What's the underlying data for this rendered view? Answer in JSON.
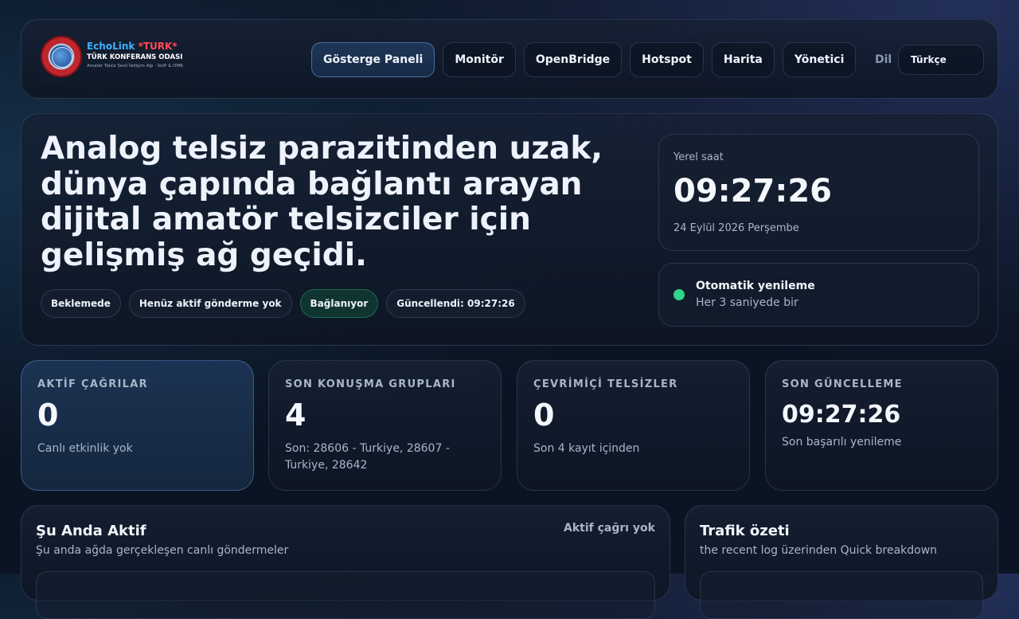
{
  "brand": {
    "title_part1": "EchoLink",
    "title_part2": "*TURK*",
    "subtitle": "TÜRK KONFERANS ODASI",
    "tagline": "Amatör Telsiz Sesli İletişim Ağı · VoIP & DMR"
  },
  "nav": {
    "items": [
      "Gösterge Paneli",
      "Monitör",
      "OpenBridge",
      "Hotspot",
      "Harita",
      "Yönetici"
    ],
    "active": "Gösterge Paneli",
    "lang_label": "Dil",
    "lang_value": "Türkçe"
  },
  "hero": {
    "title": "Analog telsiz parazitinden uzak, dünya çapında bağlantı arayan dijital amatör telsizciler için gelişmiş ağ geçidi.",
    "chips": [
      "Beklemede",
      "Henüz aktif gönderme yok",
      "Bağlanıyor",
      "Güncellendi: 09:27:26"
    ]
  },
  "clock": {
    "label": "Yerel saat",
    "time": "09:27:26",
    "date": "24 Eylül 2026 Perşembe"
  },
  "refresh": {
    "title": "Otomatik yenileme",
    "subtitle": "Her 3 saniyede bir",
    "status_color": "#2fd38a"
  },
  "stats": [
    {
      "label": "AKTİF ÇAĞRILAR",
      "value": "0",
      "desc": "Canlı etkinlik yok"
    },
    {
      "label": "SON KONUŞMA GRUPLARI",
      "value": "4",
      "desc": "Son: 28606 - Turkiye, 28607 - Turkiye, 28642"
    },
    {
      "label": "ÇEVRİMİÇİ TELSİZLER",
      "value": "0",
      "desc": "Son 4 kayıt içinden"
    },
    {
      "label": "SON GÜNCELLEME",
      "value": "09:27:26",
      "desc": "Son başarılı yenileme"
    }
  ],
  "active_now": {
    "title": "Şu Anda Aktif",
    "subtitle": "Şu anda ağda gerçekleşen canlı göndermeler",
    "badge": "Aktif çağrı yok"
  },
  "traffic": {
    "title": "Trafik özeti",
    "subtitle": "the recent log üzerinden Quick breakdown"
  },
  "colors": {
    "accent_blue": "#3fb0ff",
    "accent_red": "#ff4a55",
    "background": "#0b1422"
  }
}
